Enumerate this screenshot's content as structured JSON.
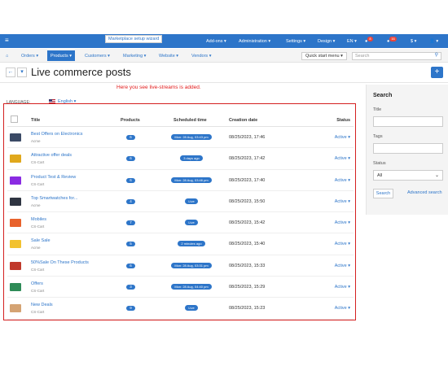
{
  "topbar": {
    "burger": "≡",
    "items": [
      "Add-ons ▾",
      "Administration ▾",
      "Settings ▾",
      "Design ▾",
      "EN ▾"
    ],
    "notif_badge": "8",
    "messages_badge": "16",
    "currency": "$ ▾",
    "user": "👤 ▾"
  },
  "wizard_callout": "Marketplace setup wizard",
  "menu": {
    "home_icon": "home-icon",
    "items": [
      "Orders ▾",
      "Products ▾",
      "Customers ▾",
      "Marketing ▾",
      "Website ▾",
      "Vendors ▾"
    ],
    "active_index": 1,
    "quick_start": "Quick start menu ▾",
    "search_placeholder": "Search",
    "search_icon": "search-icon"
  },
  "title": {
    "back_icon": "back-arrow-icon",
    "dropdown_icon": "chevron-down-icon",
    "text": "Live commerce posts",
    "add_button": "+"
  },
  "note": "Here you see live-streams is added.",
  "language": {
    "label": "LANGUAGE:",
    "value": "English ▾"
  },
  "table": {
    "headers": {
      "title": "Title",
      "products": "Products",
      "scheduled": "Scheduled time",
      "created": "Creation date",
      "status": "Status"
    },
    "rows": [
      {
        "title": "Best Offers on Electronics",
        "vendor": "Acme",
        "products": "6",
        "scheduled": "Mon: 28 Aug, 03:43 pm",
        "created": "08/25/2023, 17:46",
        "status": "Active ▾",
        "thumb_color": "#3b4a66"
      },
      {
        "title": "Attractive offer deals",
        "vendor": "CS-Cart",
        "products": "6",
        "scheduled": "3 days ago",
        "created": "08/25/2023, 17:42",
        "status": "Active ▾",
        "thumb_color": "#e0a81c"
      },
      {
        "title": "Product Test & Review",
        "vendor": "CS-Cart",
        "products": "6",
        "scheduled": "Mon: 28 Aug, 03:46 pm",
        "created": "08/25/2023, 17:40",
        "status": "Active ▾",
        "thumb_color": "#8a2be2"
      },
      {
        "title": "Top Smartwatches for...",
        "vendor": "Acme",
        "products": "4",
        "scheduled": "Live",
        "created": "08/25/2023, 15:50",
        "status": "Active ▾",
        "thumb_color": "#2f3542"
      },
      {
        "title": "Mobiles",
        "vendor": "CS-Cart",
        "products": "7",
        "scheduled": "Live",
        "created": "08/25/2023, 15:42",
        "status": "Active ▾",
        "thumb_color": "#e8622c"
      },
      {
        "title": "Sale Sale",
        "vendor": "Acme",
        "products": "5",
        "scheduled": "2 minutes ago",
        "created": "08/25/2023, 15:40",
        "status": "Active ▾",
        "thumb_color": "#f2c230"
      },
      {
        "title": "50%Sale On These Products",
        "vendor": "CS-Cart",
        "products": "6",
        "scheduled": "Mon: 28 Aug, 03:31 pm",
        "created": "08/25/2023, 15:33",
        "status": "Active ▾",
        "thumb_color": "#c0392b"
      },
      {
        "title": "Offers",
        "vendor": "CS-Cart",
        "products": "3",
        "scheduled": "Mon: 28 Aug, 04:40 pm",
        "created": "08/25/2023, 15:29",
        "status": "Active ▾",
        "thumb_color": "#2e8b57"
      },
      {
        "title": "New Deals",
        "vendor": "CS-Cart",
        "products": "9",
        "scheduled": "Live",
        "created": "08/25/2023, 15:23",
        "status": "Active ▾",
        "thumb_color": "#d4a373"
      }
    ]
  },
  "sidebar": {
    "title": "Search",
    "title_label": "Title",
    "tags_label": "Tags",
    "status_label": "Status",
    "status_value": "All",
    "search_button": "Search",
    "advanced_link": "Advanced search"
  },
  "colors": {
    "primary": "#2d75c9",
    "note_red": "#e21b1b",
    "border_red": "#d42020"
  }
}
